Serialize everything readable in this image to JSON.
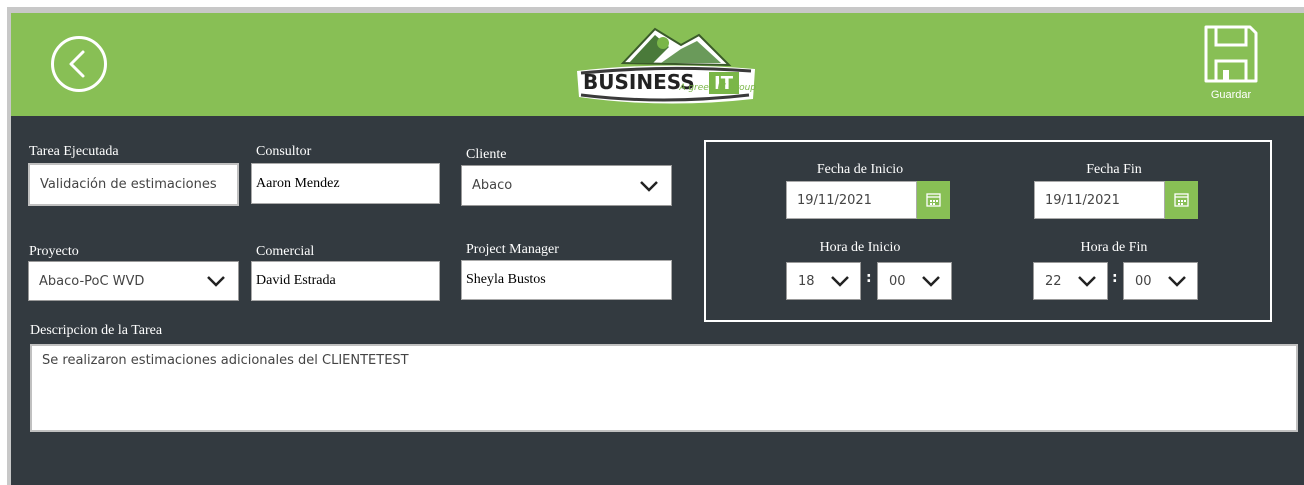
{
  "header": {
    "logo_text_main": "BUSINESS",
    "logo_text_it": "IT",
    "logo_tagline": "A green IT Group",
    "save_label": "Guardar",
    "back_icon": "chevron-left-circle-icon",
    "save_icon": "floppy-disk-icon"
  },
  "form": {
    "tarea_ejecutada": {
      "label": "Tarea Ejecutada",
      "value": "Validación de estimaciones"
    },
    "consultor": {
      "label": "Consultor",
      "value": "Aaron Mendez"
    },
    "cliente": {
      "label": "Cliente",
      "value": "Abaco"
    },
    "proyecto": {
      "label": "Proyecto",
      "value": "Abaco-PoC WVD"
    },
    "comercial": {
      "label": "Comercial",
      "value": "David Estrada"
    },
    "project_manager": {
      "label": "Project Manager",
      "value": "Sheyla Bustos"
    },
    "descripcion": {
      "label": "Descripcion de la Tarea",
      "value": "Se realizaron estimaciones adicionales del CLIENTETEST"
    }
  },
  "schedule": {
    "fecha_inicio": {
      "label": "Fecha de Inicio",
      "value": "19/11/2021"
    },
    "fecha_fin": {
      "label": "Fecha Fin",
      "value": "19/11/2021"
    },
    "hora_inicio": {
      "label": "Hora de Inicio",
      "hour": "18",
      "minute": "00"
    },
    "hora_fin": {
      "label": "Hora de Fin",
      "hour": "22",
      "minute": "00"
    },
    "separator": ":"
  },
  "colors": {
    "header_green": "#88bf55",
    "panel_dark": "#333a40",
    "text_white": "#ffffff"
  }
}
